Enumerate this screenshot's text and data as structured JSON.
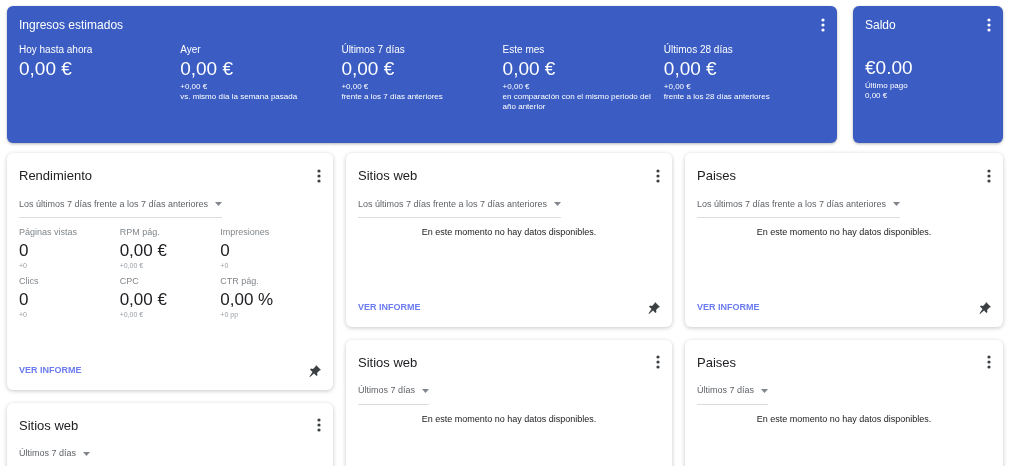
{
  "earnings": {
    "title": "Ingresos estimados",
    "columns": [
      {
        "label": "Hoy hasta ahora",
        "value": "0,00 €"
      },
      {
        "label": "Ayer",
        "value": "0,00 €",
        "delta": "+0,00 €",
        "note": "vs. mismo día la semana pasada"
      },
      {
        "label": "Últimos 7 días",
        "value": "0,00 €",
        "delta": "+0,00 €",
        "note": "frente a los 7 días anteriores"
      },
      {
        "label": "Este mes",
        "value": "0,00 €",
        "delta": "+0,00 €",
        "note": "en comparación con el mismo periodo del año anterior"
      },
      {
        "label": "Últimos 28 días",
        "value": "0,00 €",
        "delta": "+0,00 €",
        "note": "frente a los 28 días anteriores"
      }
    ]
  },
  "balance": {
    "title": "Saldo",
    "value": "€0.00",
    "label": "Último pago",
    "amount": "0,00 €"
  },
  "widget_columns": [
    [
      {
        "kind": "metrics",
        "title": "Rendimiento",
        "period": "Los últimos 7 días frente a los 7 días anteriores",
        "metrics": [
          {
            "label": "Páginas vistas",
            "value": "0",
            "delta": "+0"
          },
          {
            "label": "RPM pág.",
            "value": "0,00 €",
            "delta": "+0,00 €"
          },
          {
            "label": "Impresiones",
            "value": "0",
            "delta": "+0"
          },
          {
            "label": "Clics",
            "value": "0",
            "delta": "+0"
          },
          {
            "label": "CPC",
            "value": "0,00 €",
            "delta": "+0,00 €"
          },
          {
            "label": "CTR pág.",
            "value": "0,00 %",
            "delta": "+0 pp"
          }
        ],
        "link": "VER INFORME"
      },
      {
        "kind": "empty",
        "title": "Sitios web",
        "period": "Últimos 7 días"
      }
    ],
    [
      {
        "kind": "empty",
        "title": "Sitios web",
        "period": "Los últimos 7 días frente a los 7 días anteriores",
        "message": "En este momento no hay datos disponibles.",
        "link": "VER INFORME"
      },
      {
        "kind": "empty",
        "title": "Sitios web",
        "period": "Últimos 7 días",
        "message": "En este momento no hay datos disponibles."
      }
    ],
    [
      {
        "kind": "empty",
        "title": "Paises",
        "period": "Los últimos 7 días frente a los 7 días anteriores",
        "message": "En este momento no hay datos disponibles.",
        "link": "VER INFORME"
      },
      {
        "kind": "empty",
        "title": "Paises",
        "period": "Últimos 7 días",
        "message": "En este momento no hay datos disponibles."
      }
    ]
  ]
}
